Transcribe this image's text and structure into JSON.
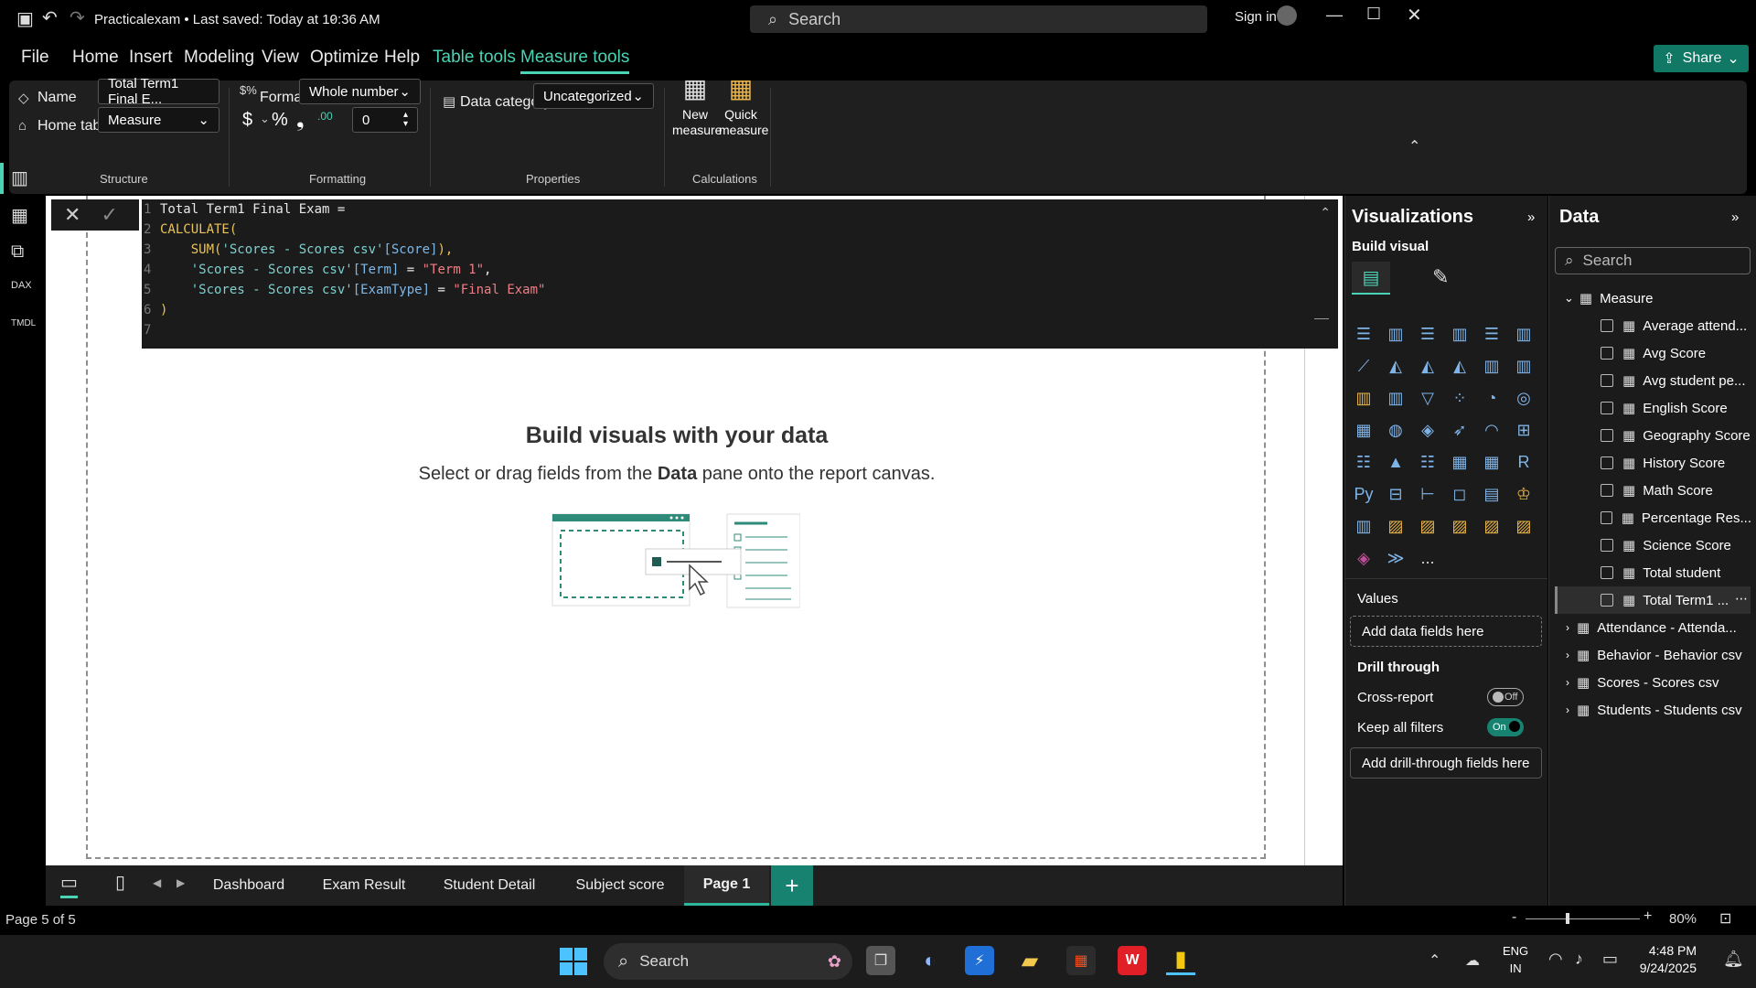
{
  "titlebar": {
    "file_title": "Practicalexam • Last saved: Today at 10:36 AM",
    "search_label": "Search",
    "sign_in": "Sign in"
  },
  "menu": {
    "items": [
      "File",
      "Home",
      "Insert",
      "Modeling",
      "View",
      "Optimize",
      "Help",
      "Table tools",
      "Measure tools"
    ],
    "share": "Share"
  },
  "ribbon": {
    "structure": {
      "name_label": "Name",
      "name_value": "Total Term1 Final E...",
      "home_table_label": "Home table",
      "home_table_value": "Measure",
      "group_title": "Structure"
    },
    "formatting": {
      "format_label": "Format",
      "format_value": "Whole number",
      "decimals_value": "0",
      "group_title": "Formatting",
      "currency_symbol": "$",
      "percent_symbol": "%",
      "comma_symbol": "❟",
      "decimal_symbol": ".00"
    },
    "properties": {
      "data_category_label": "Data category",
      "data_category_value": "Uncategorized",
      "group_title": "Properties"
    },
    "calculations": {
      "new_measure": "New measure",
      "quick_measure": "Quick measure",
      "group_title": "Calculations"
    }
  },
  "dax": {
    "line_numbers": [
      "1",
      "2",
      "3",
      "4",
      "5",
      "6",
      "7"
    ],
    "line1": "Total Term1 Final Exam =",
    "line2": "CALCULATE(",
    "line3_fn": "SUM(",
    "line3_ref": "'Scores - Scores csv'",
    "line3_col": "[Score]",
    "line3_end": "),",
    "line4_ref": "'Scores - Scores csv'",
    "line4_col": "[Term]",
    "line4_op": " = ",
    "line4_str": "\"Term 1\"",
    "line4_end": ",",
    "line5_ref": "'Scores - Scores csv'",
    "line5_col": "[ExamType]",
    "line5_op": " = ",
    "line5_str": "\"Final Exam\"",
    "line6": ")"
  },
  "canvas": {
    "empty_title": "Build visuals with your data",
    "empty_sub_pre": "Select or drag fields from the ",
    "empty_sub_bold": "Data",
    "empty_sub_post": " pane onto the report canvas."
  },
  "pages": {
    "tabs": [
      "Dashboard",
      "Exam Result",
      "Student Detail",
      "Subject score",
      "Page 1"
    ],
    "active": "Page 1",
    "add": "+"
  },
  "status": {
    "page_indicator": "Page 5 of 5",
    "zoom": "80%"
  },
  "visualizations": {
    "title": "Visualizations",
    "build_visual": "Build visual",
    "values_label": "Values",
    "add_data_fields": "Add data fields here",
    "drill_through": "Drill through",
    "cross_report": "Cross-report",
    "cross_report_state": "Off",
    "keep_all_filters": "Keep all filters",
    "keep_all_filters_state": "On",
    "add_drill_fields": "Add drill-through fields here",
    "more": "..."
  },
  "data_pane": {
    "title": "Data",
    "search_placeholder": "Search",
    "measure_table": "Measure",
    "measures": [
      "Average attend...",
      "Avg Score",
      "Avg student pe...",
      "English Score",
      "Geography Score",
      "History Score",
      "Math Score",
      "Percentage Res...",
      "Science Score",
      "Total student",
      "Total Term1 ..."
    ],
    "tables": [
      "Attendance - Attenda...",
      "Behavior - Behavior csv",
      "Scores - Scores csv",
      "Students - Students csv"
    ]
  },
  "taskbar": {
    "search": "Search",
    "lang_top": "ENG",
    "lang_bottom": "IN",
    "time": "4:48 PM",
    "date": "9/24/2025"
  },
  "colors": {
    "accent": "#4ad3b4",
    "brand_green": "#117865",
    "powerbi_yellow": "#f2c811"
  }
}
